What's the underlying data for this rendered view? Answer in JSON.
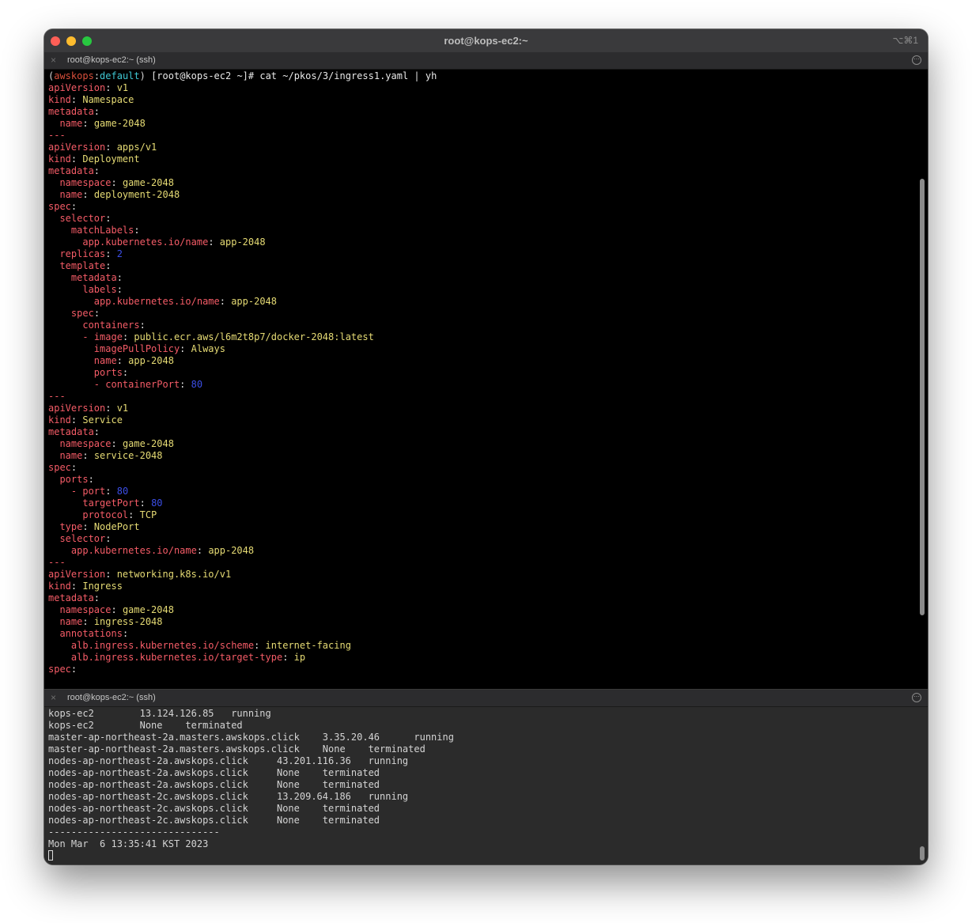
{
  "window": {
    "title": "root@kops-ec2:~",
    "shortcut": "⌥⌘1"
  },
  "tabs": [
    {
      "title": "root@kops-ec2:~ (ssh)"
    },
    {
      "title": "root@kops-ec2:~ (ssh)"
    }
  ],
  "prompt": {
    "open": "(",
    "context": "awskops",
    "sep": ":",
    "namespace": "default",
    "close": ")",
    "user_host": " [root@kops-ec2 ~]# ",
    "command": "cat ~/pkos/3/ingress1.yaml | yh"
  },
  "yaml_lines": [
    {
      "indent": "",
      "key": "apiVersion",
      "value": "v1",
      "type": "str"
    },
    {
      "indent": "",
      "key": "kind",
      "value": "Namespace",
      "type": "str"
    },
    {
      "indent": "",
      "key": "metadata",
      "value": "",
      "type": "none"
    },
    {
      "indent": "  ",
      "key": "name",
      "value": "game-2048",
      "type": "str"
    },
    {
      "sep": "---"
    },
    {
      "indent": "",
      "key": "apiVersion",
      "value": "apps/v1",
      "type": "str"
    },
    {
      "indent": "",
      "key": "kind",
      "value": "Deployment",
      "type": "str"
    },
    {
      "indent": "",
      "key": "metadata",
      "value": "",
      "type": "none"
    },
    {
      "indent": "  ",
      "key": "namespace",
      "value": "game-2048",
      "type": "str"
    },
    {
      "indent": "  ",
      "key": "name",
      "value": "deployment-2048",
      "type": "str"
    },
    {
      "indent": "",
      "key": "spec",
      "value": "",
      "type": "none"
    },
    {
      "indent": "  ",
      "key": "selector",
      "value": "",
      "type": "none"
    },
    {
      "indent": "    ",
      "key": "matchLabels",
      "value": "",
      "type": "none"
    },
    {
      "indent": "      ",
      "key": "app.kubernetes.io/name",
      "value": "app-2048",
      "type": "str"
    },
    {
      "indent": "  ",
      "key": "replicas",
      "value": "2",
      "type": "num"
    },
    {
      "indent": "  ",
      "key": "template",
      "value": "",
      "type": "none"
    },
    {
      "indent": "    ",
      "key": "metadata",
      "value": "",
      "type": "none"
    },
    {
      "indent": "      ",
      "key": "labels",
      "value": "",
      "type": "none"
    },
    {
      "indent": "        ",
      "key": "app.kubernetes.io/name",
      "value": "app-2048",
      "type": "str"
    },
    {
      "indent": "    ",
      "key": "spec",
      "value": "",
      "type": "none"
    },
    {
      "indent": "      ",
      "key": "containers",
      "value": "",
      "type": "none"
    },
    {
      "indent": "      ",
      "dash": "- ",
      "key": "image",
      "value": "public.ecr.aws/l6m2t8p7/docker-2048:latest",
      "type": "str"
    },
    {
      "indent": "        ",
      "key": "imagePullPolicy",
      "value": "Always",
      "type": "str"
    },
    {
      "indent": "        ",
      "key": "name",
      "value": "app-2048",
      "type": "str"
    },
    {
      "indent": "        ",
      "key": "ports",
      "value": "",
      "type": "none"
    },
    {
      "indent": "        ",
      "dash": "- ",
      "key": "containerPort",
      "value": "80",
      "type": "num"
    },
    {
      "sep": "---"
    },
    {
      "indent": "",
      "key": "apiVersion",
      "value": "v1",
      "type": "str"
    },
    {
      "indent": "",
      "key": "kind",
      "value": "Service",
      "type": "str"
    },
    {
      "indent": "",
      "key": "metadata",
      "value": "",
      "type": "none"
    },
    {
      "indent": "  ",
      "key": "namespace",
      "value": "game-2048",
      "type": "str"
    },
    {
      "indent": "  ",
      "key": "name",
      "value": "service-2048",
      "type": "str"
    },
    {
      "indent": "",
      "key": "spec",
      "value": "",
      "type": "none"
    },
    {
      "indent": "  ",
      "key": "ports",
      "value": "",
      "type": "none"
    },
    {
      "indent": "    ",
      "dash": "- ",
      "key": "port",
      "value": "80",
      "type": "num"
    },
    {
      "indent": "      ",
      "key": "targetPort",
      "value": "80",
      "type": "num"
    },
    {
      "indent": "      ",
      "key": "protocol",
      "value": "TCP",
      "type": "str"
    },
    {
      "indent": "  ",
      "key": "type",
      "value": "NodePort",
      "type": "str"
    },
    {
      "indent": "  ",
      "key": "selector",
      "value": "",
      "type": "none"
    },
    {
      "indent": "    ",
      "key": "app.kubernetes.io/name",
      "value": "app-2048",
      "type": "str"
    },
    {
      "sep": "---"
    },
    {
      "indent": "",
      "key": "apiVersion",
      "value": "networking.k8s.io/v1",
      "type": "str"
    },
    {
      "indent": "",
      "key": "kind",
      "value": "Ingress",
      "type": "str"
    },
    {
      "indent": "",
      "key": "metadata",
      "value": "",
      "type": "none"
    },
    {
      "indent": "  ",
      "key": "namespace",
      "value": "game-2048",
      "type": "str"
    },
    {
      "indent": "  ",
      "key": "name",
      "value": "ingress-2048",
      "type": "str"
    },
    {
      "indent": "  ",
      "key": "annotations",
      "value": "",
      "type": "none"
    },
    {
      "indent": "    ",
      "key": "alb.ingress.kubernetes.io/scheme",
      "value": "internet-facing",
      "type": "str"
    },
    {
      "indent": "    ",
      "key": "alb.ingress.kubernetes.io/target-type",
      "value": "ip",
      "type": "str"
    },
    {
      "indent": "",
      "key": "spec",
      "value": "",
      "type": "none"
    }
  ],
  "bottom_output": [
    "kops-ec2        13.124.126.85   running",
    "kops-ec2        None    terminated",
    "master-ap-northeast-2a.masters.awskops.click    3.35.20.46      running",
    "master-ap-northeast-2a.masters.awskops.click    None    terminated",
    "nodes-ap-northeast-2a.awskops.click     43.201.116.36   running",
    "nodes-ap-northeast-2a.awskops.click     None    terminated",
    "nodes-ap-northeast-2a.awskops.click     None    terminated",
    "nodes-ap-northeast-2c.awskops.click     13.209.64.186   running",
    "nodes-ap-northeast-2c.awskops.click     None    terminated",
    "nodes-ap-northeast-2c.awskops.click     None    terminated",
    "------------------------------",
    "Mon Mar  6 13:35:41 KST 2023"
  ],
  "icons": {
    "tab_close": "×",
    "tab_more": "⋯"
  },
  "colors": {
    "yaml_key": "#f55c67",
    "yaml_string": "#e6db74",
    "yaml_number": "#3b4ee6",
    "kube_context": "#d94f3b",
    "kube_namespace": "#3fc8d4"
  }
}
